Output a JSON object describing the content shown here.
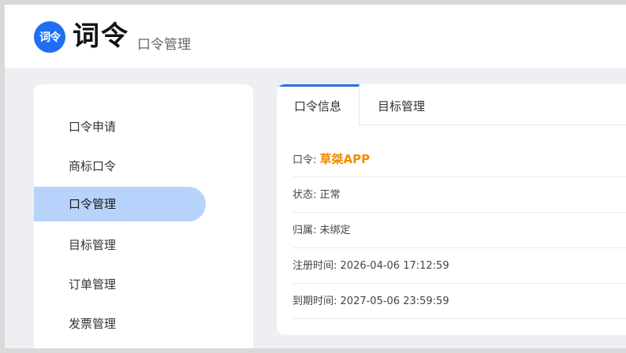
{
  "header": {
    "logo_text": "词令",
    "brand": "词令",
    "subtitle": "口令管理"
  },
  "sidebar": {
    "items": [
      {
        "label": "口令申请",
        "active": false
      },
      {
        "label": "商标口令",
        "active": false
      },
      {
        "label": "口令管理",
        "active": true
      },
      {
        "label": "目标管理",
        "active": false
      },
      {
        "label": "订单管理",
        "active": false
      },
      {
        "label": "发票管理",
        "active": false
      }
    ]
  },
  "tabs": [
    {
      "label": "口令信息",
      "active": true
    },
    {
      "label": "目标管理",
      "active": false
    }
  ],
  "info": {
    "command_label": "口令:",
    "command_value": "草桀APP",
    "status_label": "状态:",
    "status_value": "正常",
    "owner_label": "归属:",
    "owner_value": "未绑定",
    "register_label": "注册时间:",
    "register_value": "2026-04-06 17:12:59",
    "expire_label": "到期时间:",
    "expire_value": "2027-05-06 23:59:59"
  },
  "colors": {
    "accent": "#2b6fe6",
    "logo_bg": "#1f6ff0",
    "active_item_bg": "#b8d3fb",
    "highlight": "#f08c00",
    "page_bg": "#eeeff2"
  }
}
